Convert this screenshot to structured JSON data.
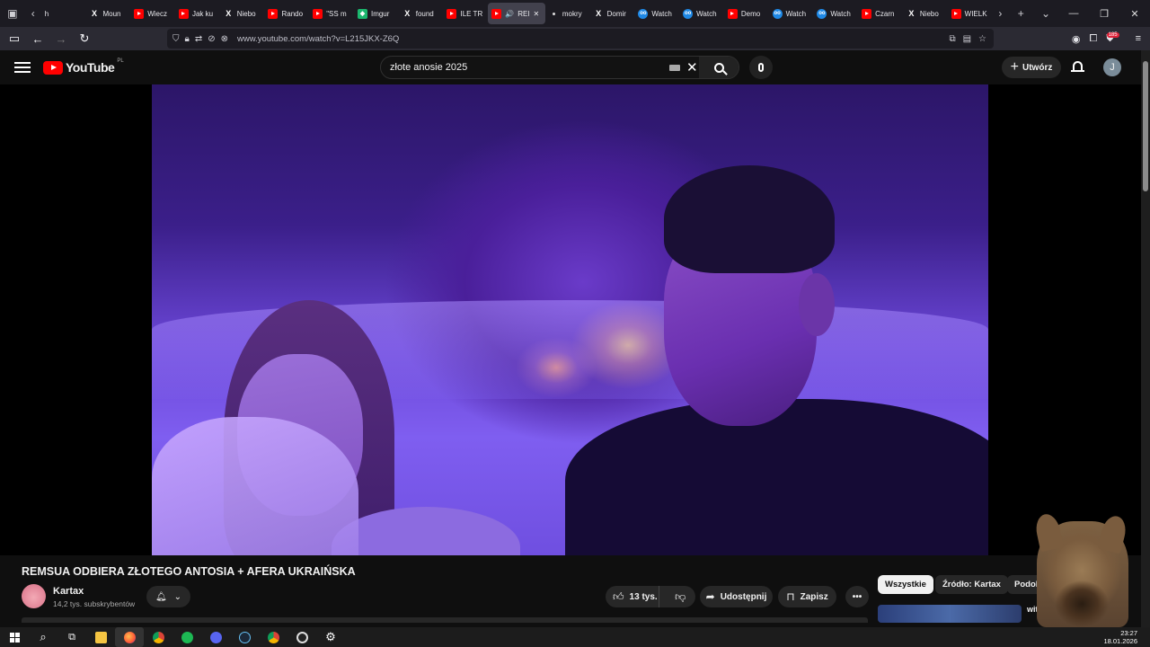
{
  "browser": {
    "tabs": [
      {
        "title": "h",
        "favicon": "chevron-left-icon"
      },
      {
        "title": "Moun",
        "favicon": "x-icon"
      },
      {
        "title": "Wiecz",
        "favicon": "youtube-icon"
      },
      {
        "title": "Jak ku",
        "favicon": "youtube-icon"
      },
      {
        "title": "Niebo",
        "favicon": "x-icon"
      },
      {
        "title": "Rando",
        "favicon": "youtube-icon"
      },
      {
        "title": "\"SS m",
        "favicon": "youtube-icon"
      },
      {
        "title": "Imgur",
        "favicon": "imgur-icon"
      },
      {
        "title": "found",
        "favicon": "x-icon"
      },
      {
        "title": "ILE TR",
        "favicon": "youtube-icon"
      },
      {
        "title": "REI",
        "favicon": "youtube-icon",
        "active": true
      },
      {
        "title": "mokry",
        "favicon": "dot-icon"
      },
      {
        "title": "Domir",
        "favicon": "x-icon"
      },
      {
        "title": "Watch",
        "favicon": "tv-icon"
      },
      {
        "title": "Watch",
        "favicon": "tv-icon"
      },
      {
        "title": "Demo",
        "favicon": "youtube-icon"
      },
      {
        "title": "Watch",
        "favicon": "tv-icon"
      },
      {
        "title": "Watch",
        "favicon": "tv-icon"
      },
      {
        "title": "Czarn",
        "favicon": "youtube-icon"
      },
      {
        "title": "Niebo",
        "favicon": "x-icon"
      },
      {
        "title": "WIELK",
        "favicon": "youtube-icon"
      }
    ],
    "url_prefix": "www.",
    "url": "www.youtube.com/watch?v=L215JKX-Z6Q",
    "notification_badge": "185"
  },
  "youtube": {
    "logo_text": "YouTube",
    "country_code": "PL",
    "search_value": "złote anosie 2025",
    "create_label": "Utwórz",
    "user_initial": "J"
  },
  "video": {
    "title": "REMSUA ODBIERA ZŁOTEGO ANTOSIA + AFERA UKRAIŃSKA",
    "channel": "Kartax",
    "subscribers": "14,2 tys. subskrybentów",
    "likes": "13 tys.",
    "share_label": "Udostępnij",
    "save_label": "Zapisz"
  },
  "sidebar": {
    "chips": [
      "Wszystkie",
      "Źródło: Kartax",
      "Podobne"
    ],
    "rec_title": "witel"
  },
  "taskbar": {
    "time": "23:27",
    "date": "18.01.2026"
  },
  "colors": {
    "brand": "#ff0000",
    "background": "#0f0f0f",
    "pill": "#272727",
    "browser_tabbar": "#1c1b22",
    "browser_toolbar": "#2b2a33"
  }
}
